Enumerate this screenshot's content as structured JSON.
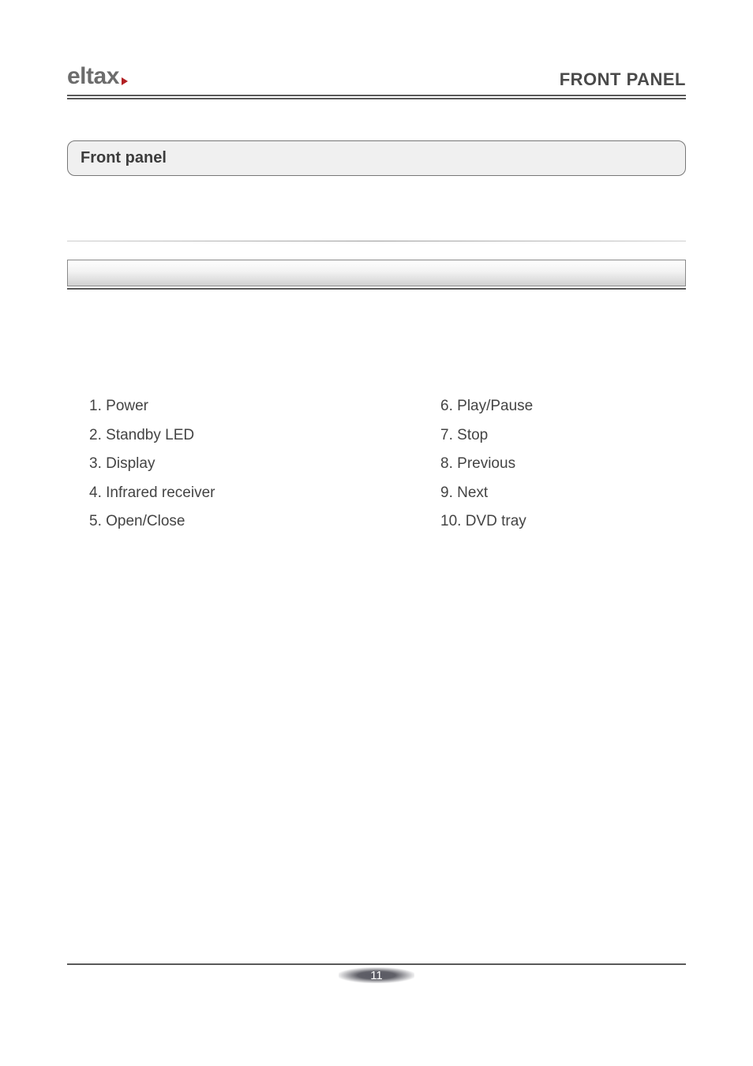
{
  "header": {
    "logo_text": "eltax",
    "page_heading": "FRONT PANEL"
  },
  "section": {
    "title": "Front panel"
  },
  "list": {
    "left": [
      {
        "num": "1.",
        "label": "Power"
      },
      {
        "num": "2.",
        "label": "Standby LED"
      },
      {
        "num": "3.",
        "label": "Display"
      },
      {
        "num": "4.",
        "label": "Infrared receiver"
      },
      {
        "num": "5.",
        "label": "Open/Close"
      }
    ],
    "right": [
      {
        "num": "6.",
        "label": "Play/Pause"
      },
      {
        "num": "7.",
        "label": "Stop"
      },
      {
        "num": "8.",
        "label": "Previous"
      },
      {
        "num": "9.",
        "label": "Next"
      },
      {
        "num": "10.",
        "label": "DVD tray"
      }
    ]
  },
  "footer": {
    "page_number": "11"
  },
  "colors": {
    "accent": "#b22023"
  }
}
